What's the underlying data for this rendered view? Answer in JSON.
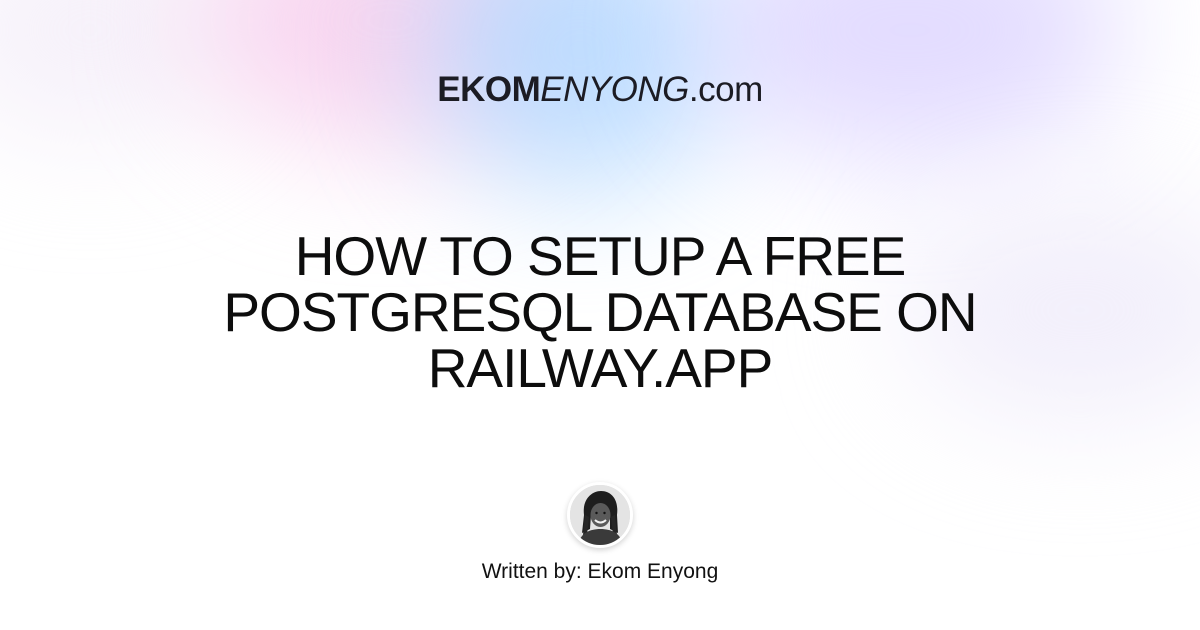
{
  "brand": {
    "bold": "EKOM",
    "italic": "ENYONG",
    "domain": ".com"
  },
  "article": {
    "title_lines": [
      "HOW TO SETUP A FREE",
      "POSTGRESQL DATABASE ON",
      "RAILWAY.APP"
    ]
  },
  "author": {
    "byline": "Written by: Ekom Enyong",
    "avatar_icon": "author-portrait"
  },
  "colors": {
    "text": "#111111",
    "background": "#ffffff"
  }
}
